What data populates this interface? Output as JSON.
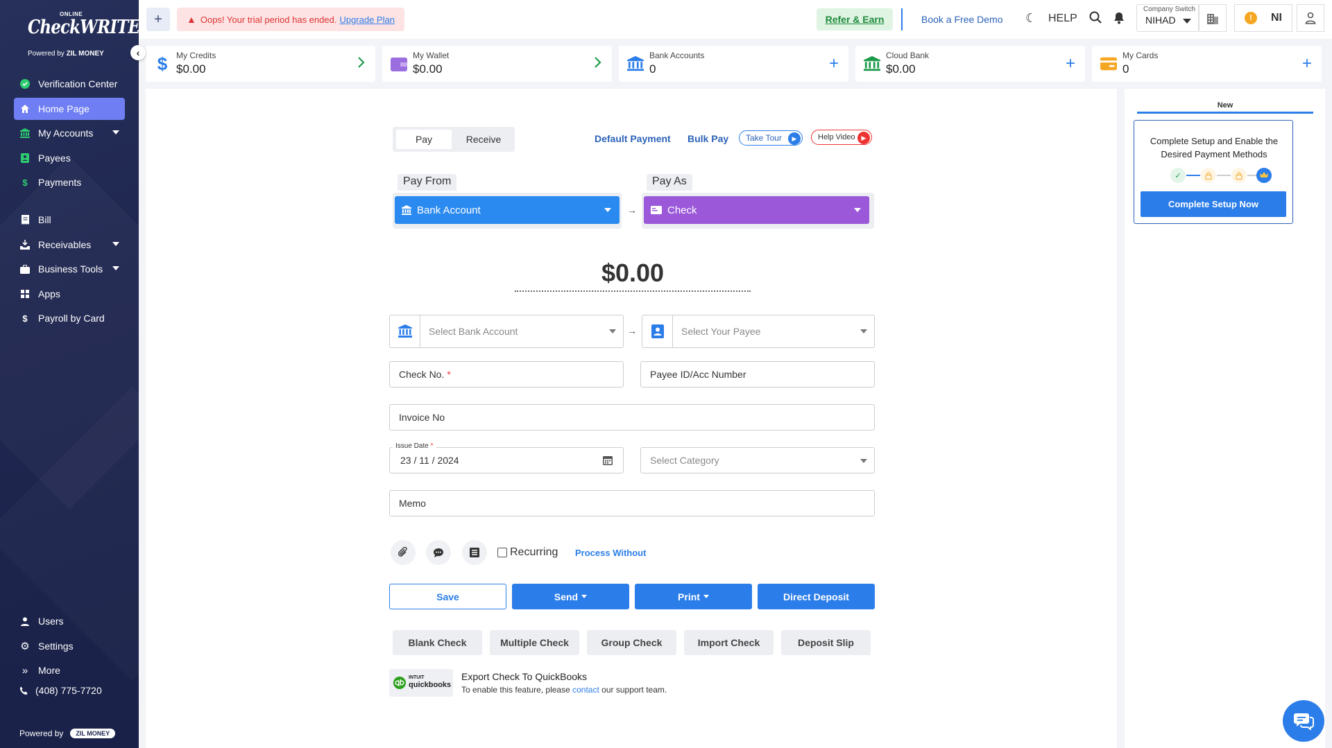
{
  "sidebar": {
    "logo": {
      "online": "ONLINE",
      "brand": "CheckWRITER",
      "powered": "Powered by",
      "powered_brand": "ZIL MONEY"
    },
    "items": [
      {
        "label": "Verification Center",
        "icon": "check-circle-icon"
      },
      {
        "label": "Home Page",
        "icon": "home-icon",
        "active": true
      },
      {
        "label": "My Accounts",
        "icon": "bank-icon",
        "has_caret": true
      },
      {
        "label": "Payees",
        "icon": "payee-icon"
      },
      {
        "label": "Payments",
        "icon": "dollar-icon"
      },
      {
        "label": "Bill",
        "icon": "bill-icon"
      },
      {
        "label": "Receivables",
        "icon": "receivables-icon",
        "has_caret": true
      },
      {
        "label": "Business Tools",
        "icon": "briefcase-icon",
        "has_caret": true
      },
      {
        "label": "Apps",
        "icon": "apps-icon"
      },
      {
        "label": "Payroll by Card",
        "icon": "dollar-icon"
      }
    ],
    "bottom_items": [
      {
        "label": "Users",
        "icon": "user-icon"
      },
      {
        "label": "Settings",
        "icon": "gear-icon"
      },
      {
        "label": "More",
        "icon": "double-chevron-icon"
      }
    ],
    "phone": "(408) 775-7720",
    "footer_powered": "Powered by",
    "footer_brand": "ZIL MONEY"
  },
  "topbar": {
    "trial_text": "Oops! Your trial period has ended.",
    "upgrade_link": "Upgrade Plan",
    "refer": "Refer & Earn",
    "demo": "Book a Free Demo",
    "help": "HELP",
    "company_label": "Company Switch",
    "company_value": "NIHAD",
    "user_initials": "NI",
    "alert_badge": "!"
  },
  "stats": [
    {
      "label": "My Credits",
      "value": "$0.00",
      "icon": "dollar-icon",
      "action": "chevron-right-icon",
      "color": "#2b7de9"
    },
    {
      "label": "My Wallet",
      "value": "$0.00",
      "icon": "wallet-icon",
      "action": "chevron-right-icon",
      "color": "#8e5cd9"
    },
    {
      "label": "Bank Accounts",
      "value": "0",
      "icon": "bank-icon",
      "action": "plus-icon",
      "color": "#2b7de9"
    },
    {
      "label": "Cloud Bank",
      "value": "$0.00",
      "icon": "bank-icon",
      "action": "plus-icon",
      "color": "#1d9a4a"
    },
    {
      "label": "My Cards",
      "value": "0",
      "icon": "card-icon",
      "action": "plus-icon",
      "color": "#f5a623"
    }
  ],
  "payment": {
    "tabs": {
      "pay": "Pay",
      "receive": "Receive"
    },
    "default_payment": "Default Payment",
    "bulk_pay": "Bulk Pay",
    "take_tour": "Take Tour",
    "help_video": "Help Video",
    "pay_from_label": "Pay From",
    "pay_from_value": "Bank Account",
    "pay_as_label": "Pay As",
    "pay_as_value": "Check",
    "amount": "$0.00",
    "bank_placeholder": "Select Bank Account",
    "payee_placeholder": "Select Your Payee",
    "check_no": "Check No.",
    "payee_id": "Payee ID/Acc Number",
    "invoice_no": "Invoice No",
    "issue_date_label": "Issue Date",
    "issue_date": "23 / 11 / 2024",
    "category_placeholder": "Select Category",
    "memo": "Memo",
    "recurring": "Recurring",
    "process_without": "Process Without",
    "buttons": {
      "save": "Save",
      "send": "Send",
      "print": "Print",
      "direct_deposit": "Direct Deposit"
    },
    "secondary": [
      "Blank Check",
      "Multiple Check",
      "Group Check",
      "Import Check",
      "Deposit Slip"
    ],
    "qb_logo_top": "INTUIT",
    "qb_logo_bottom": "quickbooks",
    "qb_title": "Export Check To QuickBooks",
    "qb_sub_before": "To enable this feature, please",
    "qb_sub_link": "contact",
    "qb_sub_after": "our support team."
  },
  "right_panel": {
    "tab": "New",
    "setup_title": "Complete Setup and Enable the Desired Payment Methods",
    "setup_button": "Complete Setup Now"
  },
  "colors": {
    "accent": "#2b7de9",
    "pay_from": "#2b8af0",
    "pay_as": "#9b59d9",
    "sidebar": "#1f2750",
    "active_nav": "#6f7ef2"
  }
}
